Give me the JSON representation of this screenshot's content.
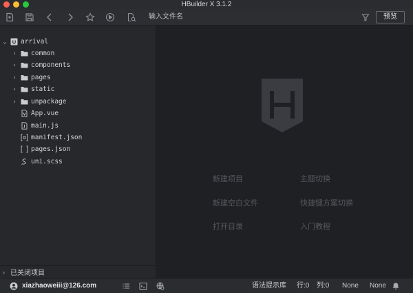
{
  "window": {
    "title": "HBuilder X 3.1.2"
  },
  "toolbar": {
    "icons": [
      "new-file-icon",
      "save-icon",
      "back-icon",
      "forward-icon",
      "star-icon",
      "run-icon",
      "file-search-icon",
      "filter-icon"
    ],
    "search_placeholder": "输入文件名",
    "preview_label": "预览"
  },
  "sidebar": {
    "tree": [
      {
        "label": "arrival",
        "type": "project",
        "expanded": true
      },
      {
        "label": "common",
        "type": "folder"
      },
      {
        "label": "components",
        "type": "folder"
      },
      {
        "label": "pages",
        "type": "folder"
      },
      {
        "label": "static",
        "type": "folder"
      },
      {
        "label": "unpackage",
        "type": "folder"
      },
      {
        "label": "App.vue",
        "type": "vue-file"
      },
      {
        "label": "main.js",
        "type": "js-file"
      },
      {
        "label": "manifest.json",
        "type": "manifest-file"
      },
      {
        "label": "pages.json",
        "type": "json-file"
      },
      {
        "label": "uni.scss",
        "type": "scss-file"
      }
    ],
    "closed_projects_label": "已关闭项目"
  },
  "welcome": {
    "links": [
      {
        "label": "新建项目"
      },
      {
        "label": "主题切换"
      },
      {
        "label": "新建空白文件"
      },
      {
        "label": "快捷键方案切换"
      },
      {
        "label": "打开目录"
      },
      {
        "label": "入门教程"
      }
    ]
  },
  "statusbar": {
    "user": "xiazhaoweiii@126.com",
    "grammar_library": "语法提示库",
    "row": "行:0",
    "col": "列:0",
    "encoding": "None",
    "language": "None"
  },
  "colors": {
    "sidebar_bg": "#26282c",
    "editor_bg": "#1f2024",
    "toolbar_bg": "#2c2e32",
    "link_color": "#56585d",
    "logo_color": "#3a3c42"
  }
}
